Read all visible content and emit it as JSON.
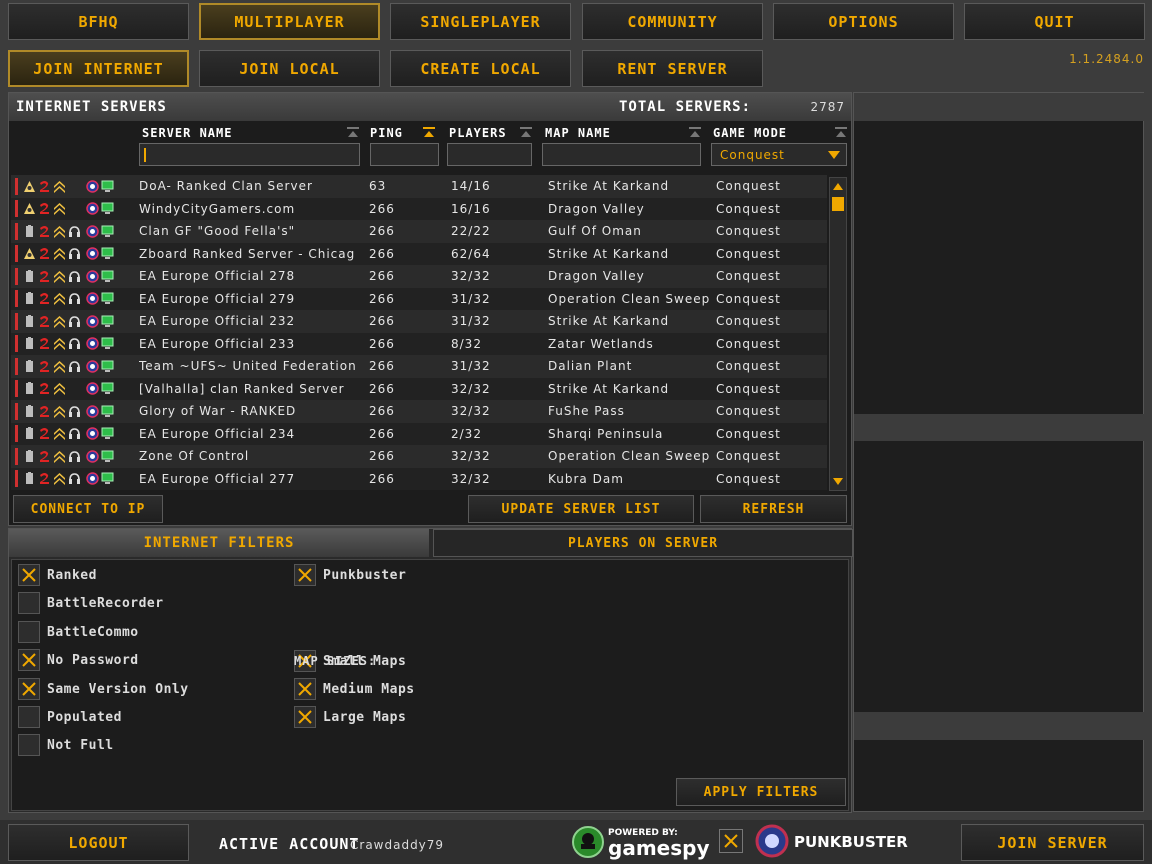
{
  "top_nav": [
    {
      "label": "BFHQ",
      "active": false
    },
    {
      "label": "MULTIPLAYER",
      "active": true
    },
    {
      "label": "SINGLEPLAYER",
      "active": false
    },
    {
      "label": "COMMUNITY",
      "active": false
    },
    {
      "label": "OPTIONS",
      "active": false
    },
    {
      "label": "QUIT",
      "active": false
    }
  ],
  "sub_nav": [
    {
      "label": "JOIN INTERNET",
      "active": true
    },
    {
      "label": "JOIN LOCAL",
      "active": false
    },
    {
      "label": "CREATE LOCAL",
      "active": false
    },
    {
      "label": "RENT SERVER",
      "active": false
    }
  ],
  "version": "1.1.2484.0",
  "servers": {
    "title": "INTERNET SERVERS",
    "total_label": "TOTAL SERVERS:",
    "total_value": "2787",
    "columns": {
      "name": "SERVER NAME",
      "ping": "PING",
      "players": "PLAYERS",
      "map": "MAP NAME",
      "mode": "GAME MODE"
    },
    "filter_name_value": "",
    "filter_mode_value": "Conquest",
    "rows": [
      {
        "name": "DoA- Ranked Clan Server",
        "ping": "63",
        "players": "14/16",
        "map": "Strike At Karkand",
        "mode": "Conquest",
        "icons": [
          "ranked-icon",
          "ea-icon",
          "rank-icon",
          "no-icon",
          "pb-icon",
          "monitor-icon"
        ]
      },
      {
        "name": "WindyCityGamers.com",
        "ping": "266",
        "players": "16/16",
        "map": "Dragon Valley",
        "mode": "Conquest",
        "icons": [
          "ranked-icon",
          "ea-icon",
          "rank-icon",
          "no-icon",
          "pb-icon",
          "monitor-icon"
        ]
      },
      {
        "name": "Clan GF \"Good Fella's\"",
        "ping": "266",
        "players": "22/22",
        "map": "Gulf Of Oman",
        "mode": "Conquest",
        "icons": [
          "battery-icon",
          "ea-icon",
          "rank-icon",
          "headset-icon",
          "pb-icon",
          "monitor-icon"
        ]
      },
      {
        "name": "Zboard Ranked Server - Chicag",
        "ping": "266",
        "players": "62/64",
        "map": "Strike At Karkand",
        "mode": "Conquest",
        "icons": [
          "ranked-icon",
          "ea-icon",
          "rank-icon",
          "headset-icon",
          "pb-icon",
          "monitor-icon"
        ]
      },
      {
        "name": "EA Europe Official 278",
        "ping": "266",
        "players": "32/32",
        "map": "Dragon Valley",
        "mode": "Conquest",
        "icons": [
          "battery-icon",
          "ea-icon",
          "rank-icon",
          "headset-icon",
          "pb-icon",
          "monitor-icon"
        ]
      },
      {
        "name": "EA Europe Official 279",
        "ping": "266",
        "players": "31/32",
        "map": "Operation Clean Sweep",
        "mode": "Conquest",
        "icons": [
          "battery-icon",
          "ea-icon",
          "rank-icon",
          "headset-icon",
          "pb-icon",
          "monitor-icon"
        ]
      },
      {
        "name": "EA Europe Official 232",
        "ping": "266",
        "players": "31/32",
        "map": "Strike At Karkand",
        "mode": "Conquest",
        "icons": [
          "battery-icon",
          "ea-icon",
          "rank-icon",
          "headset-icon",
          "pb-icon",
          "monitor-icon"
        ]
      },
      {
        "name": "EA Europe Official 233",
        "ping": "266",
        "players": "8/32",
        "map": "Zatar Wetlands",
        "mode": "Conquest",
        "icons": [
          "battery-icon",
          "ea-icon",
          "rank-icon",
          "headset-icon",
          "pb-icon",
          "monitor-icon"
        ]
      },
      {
        "name": "Team ~UFS~ United Federation",
        "ping": "266",
        "players": "31/32",
        "map": "Dalian Plant",
        "mode": "Conquest",
        "icons": [
          "battery-icon",
          "ea-icon",
          "rank-icon",
          "headset-icon",
          "pb-icon",
          "monitor-icon"
        ]
      },
      {
        "name": "[Valhalla] clan Ranked Server",
        "ping": "266",
        "players": "32/32",
        "map": "Strike At Karkand",
        "mode": "Conquest",
        "icons": [
          "battery-icon",
          "ea-icon",
          "rank-icon",
          "no-icon",
          "pb-icon",
          "monitor-icon"
        ]
      },
      {
        "name": "Glory of War - RANKED",
        "ping": "266",
        "players": "32/32",
        "map": "FuShe Pass",
        "mode": "Conquest",
        "icons": [
          "battery-icon",
          "ea-icon",
          "rank-icon",
          "headset-icon",
          "pb-icon",
          "monitor-icon"
        ]
      },
      {
        "name": "EA Europe Official 234",
        "ping": "266",
        "players": "2/32",
        "map": "Sharqi Peninsula",
        "mode": "Conquest",
        "icons": [
          "battery-icon",
          "ea-icon",
          "rank-icon",
          "headset-icon",
          "pb-icon",
          "monitor-icon"
        ]
      },
      {
        "name": "Zone Of Control",
        "ping": "266",
        "players": "32/32",
        "map": "Operation Clean Sweep",
        "mode": "Conquest",
        "icons": [
          "battery-icon",
          "ea-icon",
          "rank-icon",
          "headset-icon",
          "pb-icon",
          "monitor-icon"
        ]
      },
      {
        "name": "EA Europe Official 277",
        "ping": "266",
        "players": "32/32",
        "map": "Kubra Dam",
        "mode": "Conquest",
        "icons": [
          "battery-icon",
          "ea-icon",
          "rank-icon",
          "headset-icon",
          "pb-icon",
          "monitor-icon"
        ]
      }
    ],
    "connect_ip_label": "CONNECT TO IP",
    "update_label": "UPDATE SERVER LIST",
    "refresh_label": "REFRESH"
  },
  "filters": {
    "tab_filters": "INTERNET FILTERS",
    "tab_players": "PLAYERS ON SERVER",
    "left": [
      {
        "label": "Ranked",
        "checked": true
      },
      {
        "label": "BattleRecorder",
        "checked": false
      },
      {
        "label": "BattleCommo",
        "checked": false
      },
      {
        "label": "No Password",
        "checked": true
      },
      {
        "label": "Same Version Only",
        "checked": true
      },
      {
        "label": "Populated",
        "checked": false
      },
      {
        "label": "Not Full",
        "checked": false
      }
    ],
    "punkbuster": {
      "label": "Punkbuster",
      "checked": true
    },
    "map_sizes_label": "MAP SIZES:",
    "map_sizes": [
      {
        "label": "Small Maps",
        "checked": true
      },
      {
        "label": "Medium Maps",
        "checked": true
      },
      {
        "label": "Large Maps",
        "checked": true
      }
    ],
    "apply_label": "APPLY FILTERS"
  },
  "footer": {
    "logout_label": "LOGOUT",
    "active_label": "ACTIVE ACCOUNT",
    "account_name": "Crawdaddy79",
    "gamespy_top": "POWERED BY:",
    "gamespy_brand": "gamespy",
    "punkbuster_brand": "PUNKBUSTER",
    "join_label": "JOIN SERVER"
  },
  "colors": {
    "accent": "#f0a800",
    "panel": "#1c1c1c"
  }
}
